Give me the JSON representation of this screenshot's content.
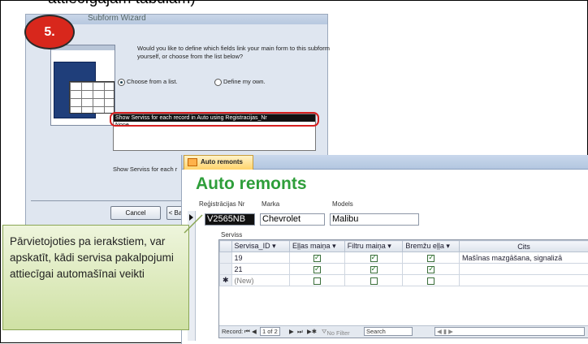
{
  "top_text": "attiecīgajām tabulām)",
  "step": "5.",
  "wizard": {
    "title": "Subform Wizard",
    "question": "Would you like to define which fields link your main form to this subform yourself, or choose from the list below?",
    "radio_choose": "Choose from a list.",
    "radio_define": "Define my own.",
    "list_items": [
      "Show Serviss for each record in Auto using Registracijas_Nr",
      "None"
    ],
    "show_text": "Show Serviss for each r",
    "cancel": "Cancel",
    "back": "< Back"
  },
  "form": {
    "tab": "Auto remonts",
    "title": "Auto remonts",
    "labels": {
      "reg": "Reģistrācijas Nr",
      "marka": "Marka",
      "modelis": "Models",
      "serviss": "Serviss"
    },
    "values": {
      "reg": "V2565NB",
      "marka": "Chevrolet",
      "modelis": "Malibu"
    },
    "columns": [
      "Servisa_ID",
      "Eļļas maiņa",
      "Filtru maiņa",
      "Bremžu eļļa",
      "Cits"
    ],
    "rows": [
      {
        "id": "19",
        "c1": true,
        "c2": true,
        "c3": true,
        "cits": "Mašīnas mazgāšana, signalizā"
      },
      {
        "id": "21",
        "c1": true,
        "c2": true,
        "c3": true,
        "cits": ""
      }
    ],
    "new_row": "(New)",
    "nav": {
      "record": "Record:",
      "pos": "1 of 2",
      "filter": "No Filter",
      "search": "Search"
    }
  },
  "callout": "Pārvietojoties pa ierakstiem, var apskatīt, kādi servisa pakalpojumi attiecīgai automašīnai veikti"
}
